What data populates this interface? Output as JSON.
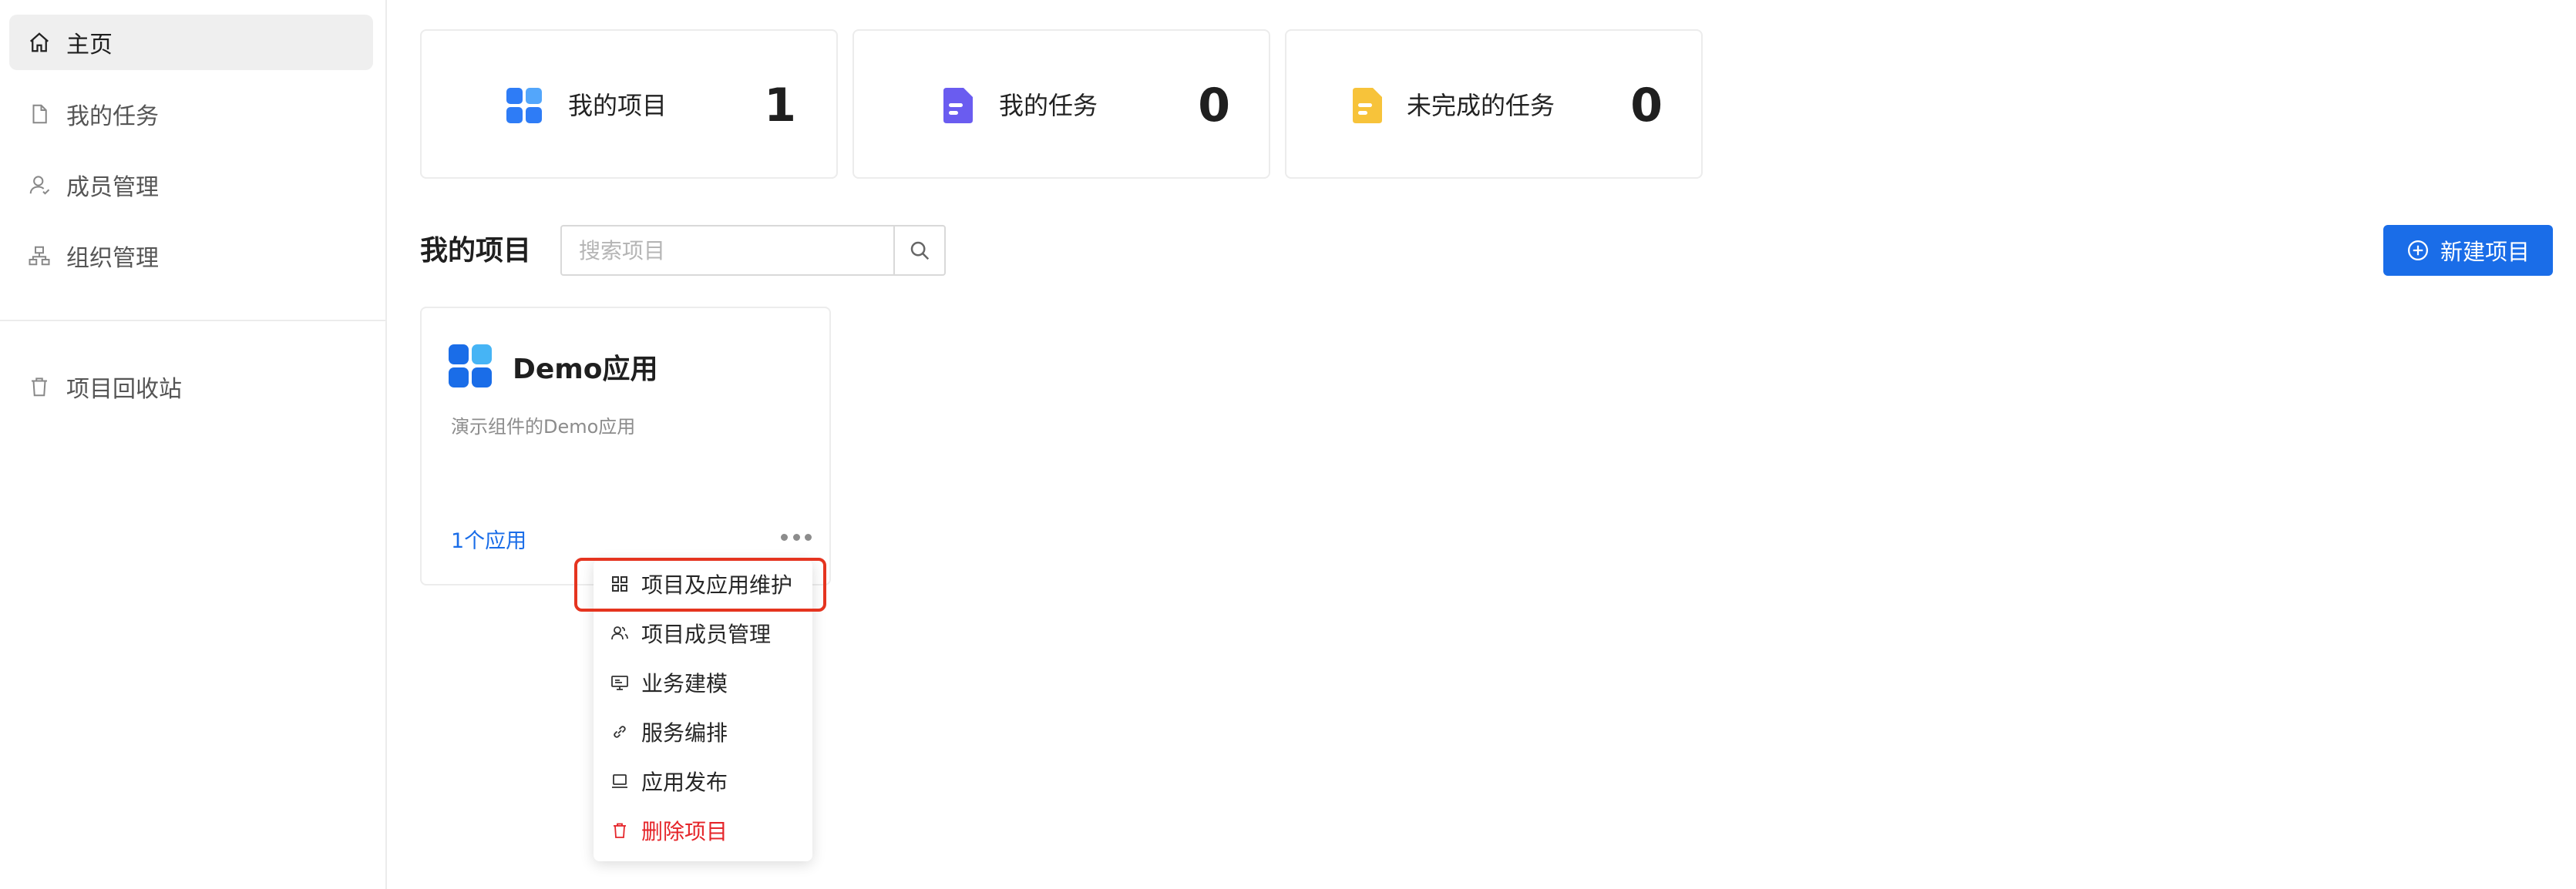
{
  "sidebar": {
    "items": [
      {
        "label": "主页",
        "icon": "home-icon",
        "active": true
      },
      {
        "label": "我的任务",
        "icon": "file-icon"
      },
      {
        "label": "成员管理",
        "icon": "user-icon"
      },
      {
        "label": "组织管理",
        "icon": "org-icon"
      },
      {
        "label": "项目回收站",
        "icon": "trash-icon"
      }
    ]
  },
  "stats": [
    {
      "label": "我的项目",
      "value": "1",
      "icon": "apps-grid-icon",
      "color": "#2e7cf6"
    },
    {
      "label": "我的任务",
      "value": "0",
      "icon": "document-icon",
      "color": "#6a5cf0"
    },
    {
      "label": "未完成的任务",
      "value": "0",
      "icon": "document-icon",
      "color": "#f7c33a"
    }
  ],
  "projects_section": {
    "title": "我的项目",
    "search_placeholder": "搜索项目",
    "new_button_label": "新建项目"
  },
  "project_card": {
    "name": "Demo应用",
    "description": "演示组件的Demo应用",
    "apps_count": "1个应用"
  },
  "menu": {
    "items": [
      {
        "label": "项目及应用维护",
        "icon": "grid-icon",
        "highlighted": true
      },
      {
        "label": "项目成员管理",
        "icon": "members-icon"
      },
      {
        "label": "业务建模",
        "icon": "monitor-icon"
      },
      {
        "label": "服务编排",
        "icon": "link-icon"
      },
      {
        "label": "应用发布",
        "icon": "laptop-icon"
      },
      {
        "label": "删除项目",
        "icon": "trash-icon",
        "danger": true
      }
    ]
  },
  "colors": {
    "primary": "#1a6de8",
    "danger": "#e5252a",
    "highlight_border": "#e5341f"
  }
}
